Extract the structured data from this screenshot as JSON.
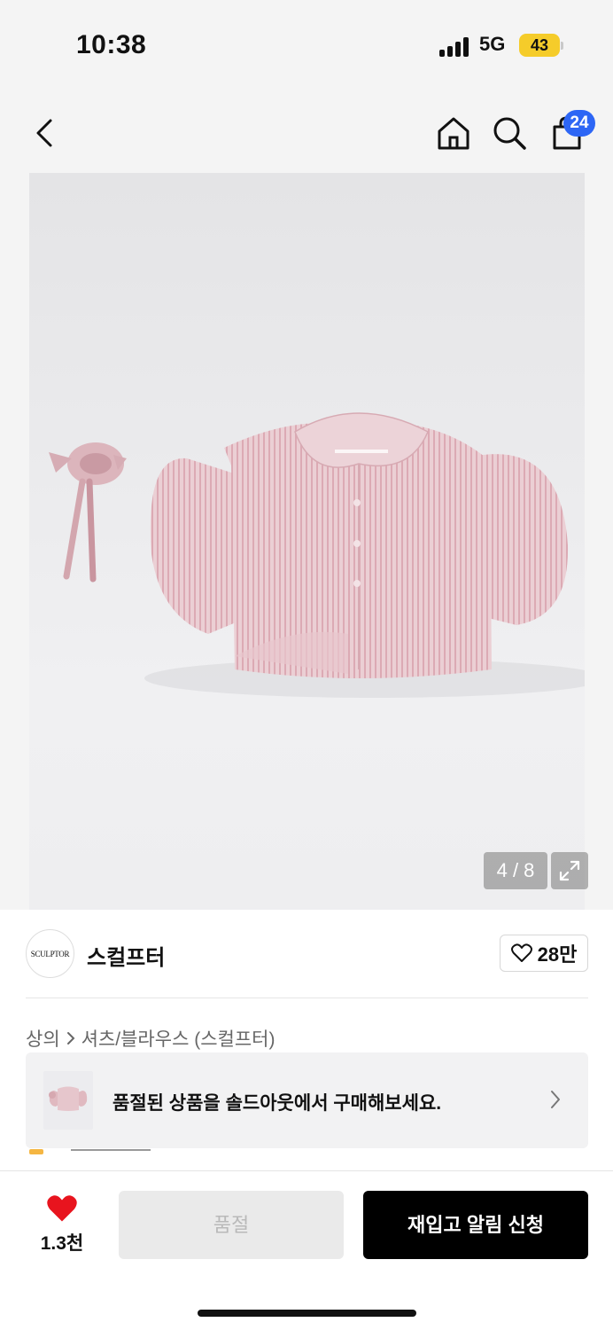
{
  "status": {
    "time": "10:38",
    "network": "5G",
    "battery": "43"
  },
  "header": {
    "cart_count": "24",
    "icons": [
      "back-arrow-icon",
      "home-icon",
      "search-icon",
      "shopping-bag-icon"
    ]
  },
  "gallery": {
    "counter": "4 / 8"
  },
  "brand": {
    "logo_text": "SCULPTOR",
    "name": "스컬프터",
    "like_count": "28만"
  },
  "breadcrumb": {
    "category": "상의",
    "subcategory": "셔츠/블라우스 (스컬프터)"
  },
  "soldout_notice": {
    "text": "품절된 상품을 솔드아웃에서 구매해보세요."
  },
  "bottom_bar": {
    "wish_count": "1.3천",
    "soldout_label": "품절",
    "restock_label": "재입고 알림 신청"
  },
  "colors": {
    "accent_blue": "#2d66f5",
    "heart_red": "#e8141e",
    "battery_yellow": "#f5cc2a"
  }
}
